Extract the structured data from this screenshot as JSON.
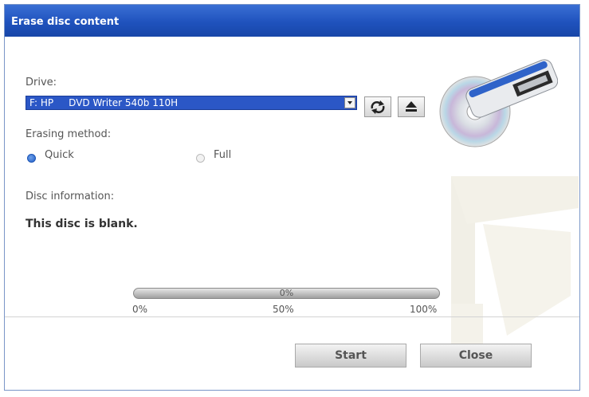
{
  "window": {
    "title": "Erase disc content"
  },
  "drive": {
    "label": "Drive:",
    "selected": "F: HP     DVD Writer 540b 110H",
    "refresh_icon": "refresh-icon",
    "eject_icon": "eject-icon"
  },
  "erasing": {
    "label": "Erasing method:",
    "options": [
      {
        "label": "Quick",
        "selected": true
      },
      {
        "label": "Full",
        "selected": false
      }
    ]
  },
  "disc_info": {
    "label": "Disc information:",
    "message": "This disc is blank."
  },
  "progress": {
    "value": 0,
    "text": "0%",
    "ticks": [
      "0%",
      "50%",
      "100%"
    ]
  },
  "buttons": {
    "start": "Start",
    "close": "Close"
  },
  "colors": {
    "titlebar": "#2458c6",
    "selection": "#2b57c6"
  }
}
